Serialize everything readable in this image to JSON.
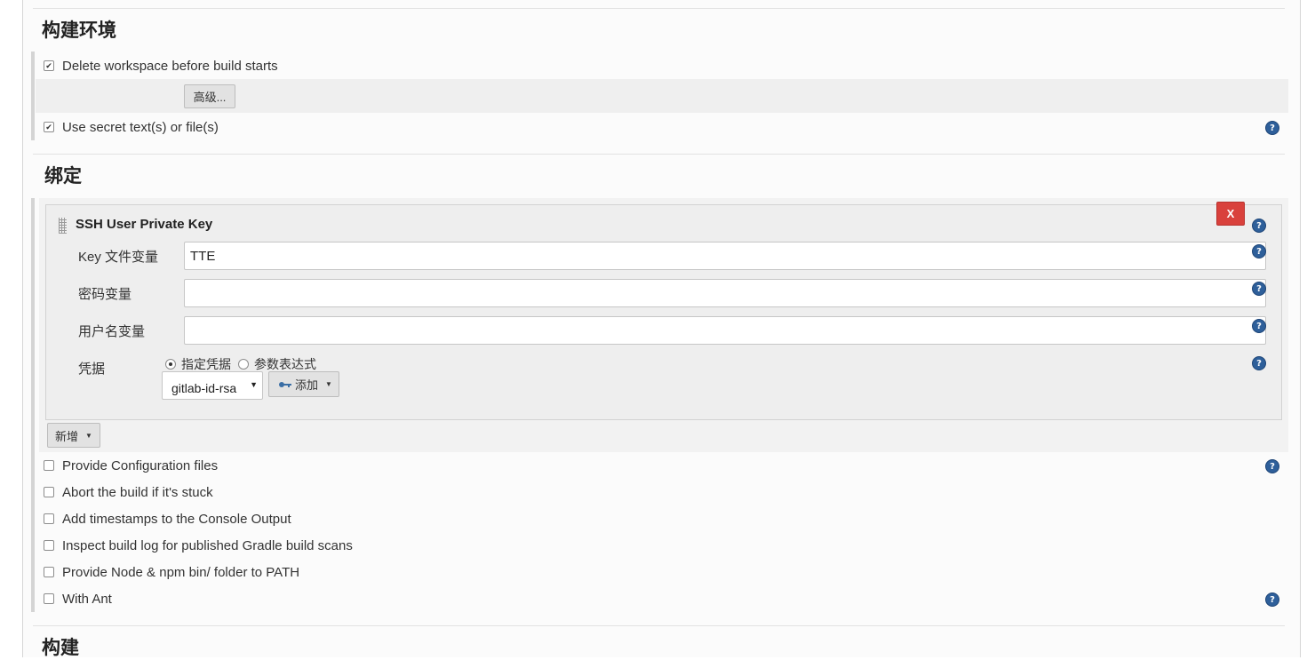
{
  "sections": {
    "build_env_title": "构建环境",
    "bindings_title": "绑定",
    "build_title": "构建"
  },
  "options": {
    "delete_workspace": {
      "label": "Delete workspace before build starts",
      "checked": true
    },
    "advanced_button": "高级...",
    "use_secret": {
      "label": "Use secret text(s) or file(s)",
      "checked": true
    },
    "provide_config": "Provide Configuration files",
    "abort_stuck": "Abort the build if it's stuck",
    "timestamps": "Add timestamps to the Console Output",
    "inspect_gradle": "Inspect build log for published Gradle build scans",
    "node_npm": "Provide Node & npm bin/ folder to PATH",
    "with_ant": "With Ant"
  },
  "binding": {
    "title": "SSH User Private Key",
    "delete_label": "X",
    "key_file_var_label": "Key 文件变量",
    "key_file_var_value": "TTE",
    "passphrase_var_label": "密码变量",
    "passphrase_var_value": "",
    "username_var_label": "用户名变量",
    "username_var_value": "",
    "credentials_label": "凭据",
    "radio_specific": "指定凭据",
    "radio_expression": "参数表达式",
    "credential_selected": "gitlab-id-rsa",
    "add_button": "添加",
    "add_new_button": "新增"
  },
  "help_icon_text": "?",
  "colors": {
    "delete_button": "#d9413c",
    "help_icon": "#2e5f9a"
  }
}
